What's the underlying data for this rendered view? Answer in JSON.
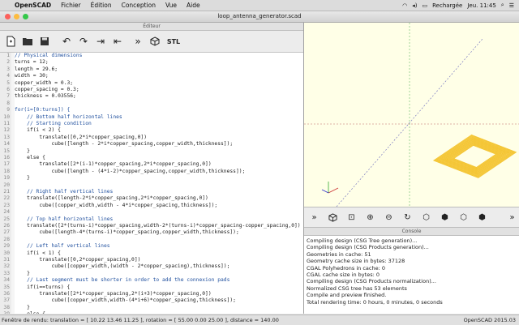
{
  "menubar": {
    "apple": "",
    "app": "OpenSCAD",
    "items": [
      "Fichier",
      "Édition",
      "Conception",
      "Vue",
      "Aide"
    ],
    "battery": "Rechargée",
    "clock": "Jeu. 11:45"
  },
  "window": {
    "title": "loop_antenna_generator.scad"
  },
  "editor": {
    "header": "Éditeur",
    "toolbar": {
      "new": "new-file-icon",
      "open": "open-folder-icon",
      "save": "save-icon",
      "undo": "undo-icon",
      "redo": "redo-icon",
      "indent": "indent-icon",
      "unindent": "unindent-icon",
      "preview": "preview-icon",
      "render": "render-icon",
      "stl": "STL"
    },
    "lines": [
      {
        "n": "1",
        "text": "// Physical dimensions",
        "cls": "cm"
      },
      {
        "n": "2",
        "text": "turns = 12;",
        "cls": ""
      },
      {
        "n": "3",
        "text": "length = 29.6;",
        "cls": ""
      },
      {
        "n": "4",
        "text": "width = 30;",
        "cls": ""
      },
      {
        "n": "5",
        "text": "copper_width = 0.3;",
        "cls": ""
      },
      {
        "n": "6",
        "text": "copper_spacing = 0.3;",
        "cls": ""
      },
      {
        "n": "7",
        "text": "thickness = 0.03556;",
        "cls": ""
      },
      {
        "n": "8",
        "text": "",
        "cls": ""
      },
      {
        "n": "9",
        "text": "for(i=[0:turns]) {",
        "cls": "kw"
      },
      {
        "n": "10",
        "text": "    // Bottom half horizontal lines",
        "cls": "cm"
      },
      {
        "n": "11",
        "text": "    // Starting condition",
        "cls": "cm"
      },
      {
        "n": "12",
        "text": "    if(i < 2) {",
        "cls": ""
      },
      {
        "n": "13",
        "text": "        translate([0,2*i*copper_spacing,0])",
        "cls": ""
      },
      {
        "n": "14",
        "text": "            cube([length - 2*i*copper_spacing,copper_width,thickness]);",
        "cls": ""
      },
      {
        "n": "15",
        "text": "    }",
        "cls": ""
      },
      {
        "n": "16",
        "text": "    else {",
        "cls": ""
      },
      {
        "n": "17",
        "text": "        translate([2*(i-1)*copper_spacing,2*i*copper_spacing,0])",
        "cls": ""
      },
      {
        "n": "18",
        "text": "            cube([length - (4*i-2)*copper_spacing,copper_width,thickness]);",
        "cls": ""
      },
      {
        "n": "19",
        "text": "    }",
        "cls": ""
      },
      {
        "n": "20",
        "text": "",
        "cls": ""
      },
      {
        "n": "21",
        "text": "    // Right half vertical lines",
        "cls": "cm"
      },
      {
        "n": "22",
        "text": "    translate([length-2*i*copper_spacing,2*i*copper_spacing,0])",
        "cls": ""
      },
      {
        "n": "23",
        "text": "        cube([copper_width,width - 4*i*copper_spacing,thickness]);",
        "cls": ""
      },
      {
        "n": "24",
        "text": "",
        "cls": ""
      },
      {
        "n": "25",
        "text": "    // Top half horizontal lines",
        "cls": "cm"
      },
      {
        "n": "26",
        "text": "    translate([2*(turns-i)*copper_spacing,width-2*(turns-i)*copper_spacing-copper_spacing,0])",
        "cls": ""
      },
      {
        "n": "27",
        "text": "        cube([length-4*(turns-i)*copper_spacing,copper_width,thickness]);",
        "cls": ""
      },
      {
        "n": "28",
        "text": "",
        "cls": ""
      },
      {
        "n": "29",
        "text": "    // Left half vertical lines",
        "cls": "cm"
      },
      {
        "n": "30",
        "text": "    if(i < 1) {",
        "cls": ""
      },
      {
        "n": "31",
        "text": "        translate([0,2*copper_spacing,0])",
        "cls": ""
      },
      {
        "n": "32",
        "text": "            cube([copper_width,(width - 2*copper_spacing),thickness]);",
        "cls": ""
      },
      {
        "n": "33",
        "text": "    }",
        "cls": ""
      },
      {
        "n": "34",
        "text": "    // Last segment must be shorter in order to add the connexion pads",
        "cls": "cm"
      },
      {
        "n": "35",
        "text": "    if(i==turns) {",
        "cls": ""
      },
      {
        "n": "36",
        "text": "        translate([2*i*copper_spacing,2*(i+3)*copper_spacing,0])",
        "cls": ""
      },
      {
        "n": "37",
        "text": "            cube([copper_width,width-(4*i+6)*copper_spacing,thickness]);",
        "cls": ""
      },
      {
        "n": "38",
        "text": "    }",
        "cls": ""
      },
      {
        "n": "39",
        "text": "    else {",
        "cls": ""
      }
    ]
  },
  "viewport": {
    "background": "#ffffe7",
    "model_color": "#f4c430"
  },
  "view_toolbar": {
    "icons": [
      "preview-icon",
      "render-icon",
      "zoom-all-icon",
      "zoom-in-icon",
      "zoom-out-icon",
      "reset-view-icon",
      "view-right-icon",
      "view-top-icon",
      "view-bottom-icon",
      "view-left-icon",
      "more-icon"
    ],
    "more": "»"
  },
  "console": {
    "header": "Console",
    "lines": [
      "Compiling design (CSG Tree generation)...",
      "Compiling design (CSG Products generation)...",
      "Geometries in cache: 51",
      "Geometry cache size in bytes: 37128",
      "CGAL Polyhedrons in cache: 0",
      "CGAL cache size in bytes: 0",
      "Compiling design (CSG Products normalization)...",
      "Normalized CSG tree has 53 elements",
      "Compile and preview finished.",
      "Total rendering time: 0 hours, 0 minutes, 0 seconds"
    ]
  },
  "statusbar": {
    "left": "Fenêtre de rendu: translation = [ 10.22 13.46 11.25 ], rotation = [ 55.00 0.00 25.00 ], distance = 140.00",
    "right": "OpenSCAD 2015.03"
  }
}
